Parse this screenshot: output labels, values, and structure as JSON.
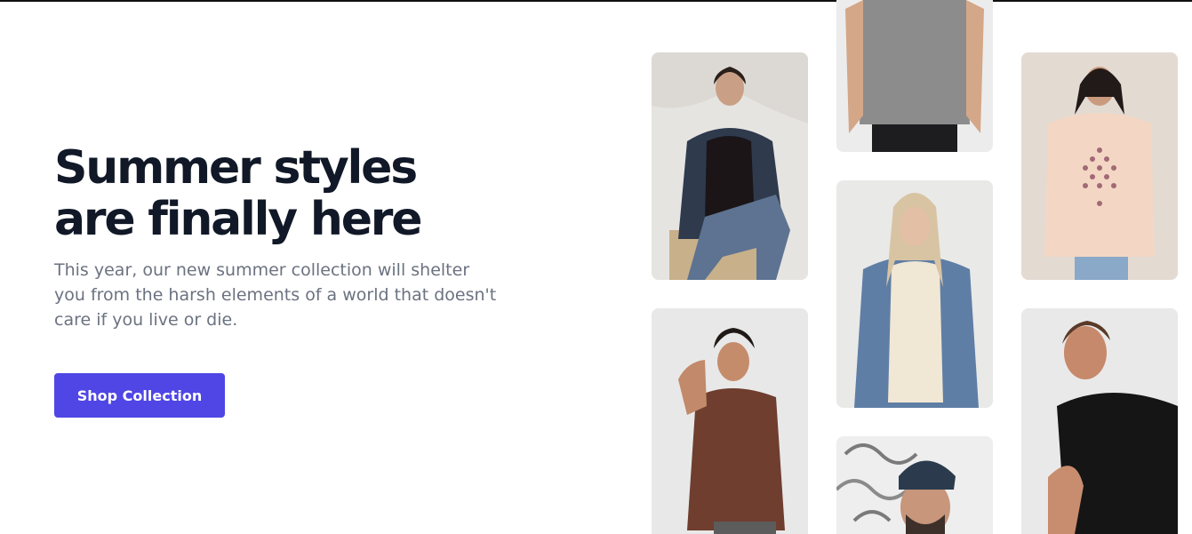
{
  "hero": {
    "headline_line1": "Summer styles",
    "headline_line2": "are finally here",
    "description": "This year, our new summer collection will shelter you from the harsh elements of a world that doesn't care if you live or die.",
    "cta_label": "Shop Collection"
  },
  "colors": {
    "accent": "#4f46e5",
    "headline": "#111827",
    "body_text": "#6b7280"
  },
  "gallery": {
    "images": [
      "woman-denim-jacket-black-tee",
      "man-grey-tee-torso",
      "woman-peach-graphic-tee",
      "blonde-woman-denim-jacket",
      "man-brown-tee-curly-hair",
      "man-beanie-glasses",
      "man-black-tee"
    ]
  }
}
